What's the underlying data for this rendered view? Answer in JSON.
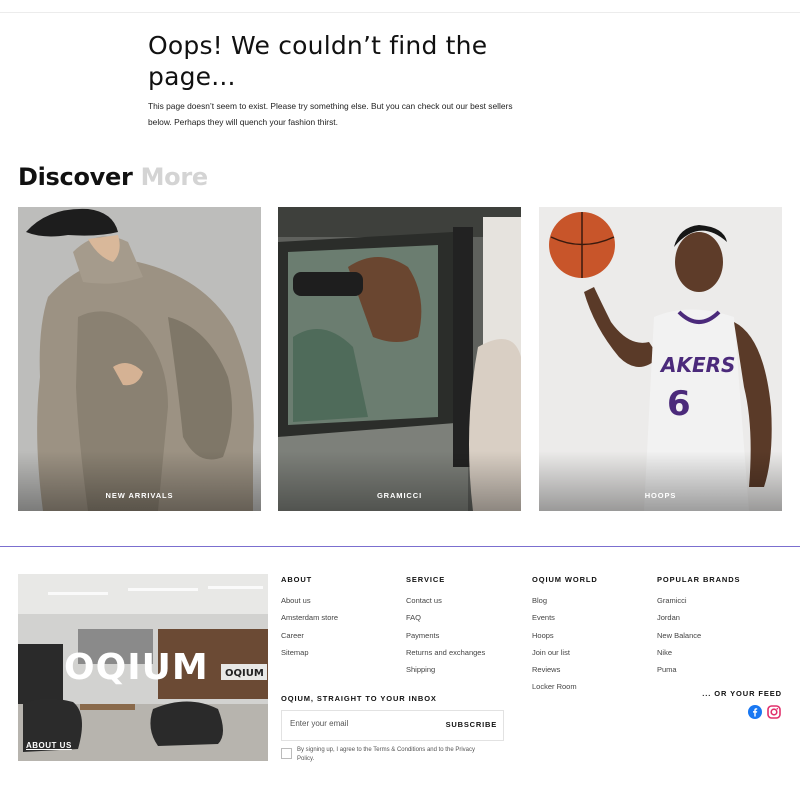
{
  "error": {
    "title": "Oops! We couldn’t find the page...",
    "message": "This page doesn’t seem to exist. Please try something else. But you can check out our best sellers below. Perhaps they will quench your fashion thirst."
  },
  "discover": {
    "title_main": "Discover",
    "title_accent": "More"
  },
  "cards": [
    {
      "label": "NEW ARRIVALS"
    },
    {
      "label": "GRAMICCI"
    },
    {
      "label": "HOOPS"
    }
  ],
  "footer": {
    "image": {
      "brand_text": "OQIUM",
      "sign_text": "OQIUM",
      "link_label": "ABOUT US"
    },
    "columns": [
      {
        "title": "ABOUT",
        "links": [
          "About us",
          "Amsterdam store",
          "Career",
          "Sitemap"
        ]
      },
      {
        "title": "SERVICE",
        "links": [
          "Contact us",
          "FAQ",
          "Payments",
          "Returns and exchanges",
          "Shipping"
        ]
      },
      {
        "title": "OQIUM WORLD",
        "links": [
          "Blog",
          "Events",
          "Hoops",
          "Join our list",
          "Reviews",
          "Locker Room"
        ]
      },
      {
        "title": "POPULAR BRANDS",
        "links": [
          "Gramicci",
          "Jordan",
          "New Balance",
          "Nike",
          "Puma"
        ]
      }
    ],
    "newsletter": {
      "title": "OQIUM, STRAIGHT TO YOUR INBOX",
      "placeholder": "Enter your email",
      "button": "SUBSCRIBE",
      "consent": "By signing up, I agree to the Terms & Conditions and to the Privacy Policy."
    },
    "social": {
      "title": "... OR YOUR FEED",
      "icons": [
        "facebook-icon",
        "instagram-icon"
      ]
    }
  },
  "colors": {
    "accent_divider": "#7b6fcf",
    "facebook": "#1877f2",
    "instagram": "#e1306c",
    "muted_text": "#d4d4d4"
  }
}
